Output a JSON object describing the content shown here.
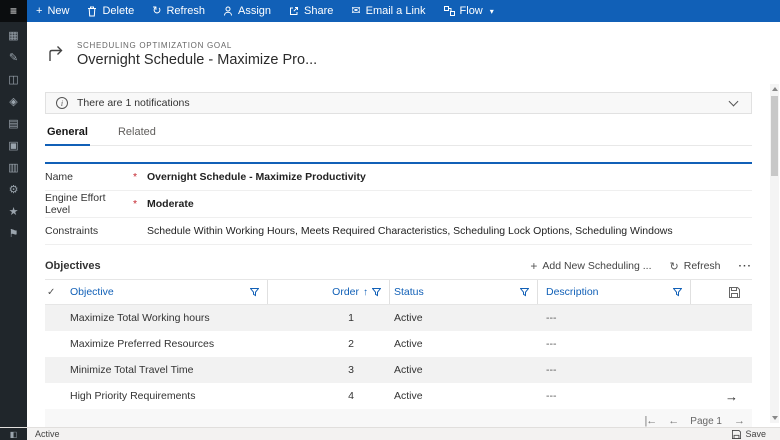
{
  "command_bar": {
    "menu_glyph": "≡",
    "items": [
      {
        "label": "New"
      },
      {
        "label": "Delete"
      },
      {
        "label": "Refresh"
      },
      {
        "label": "Assign"
      },
      {
        "label": "Share"
      },
      {
        "label": "Email a Link"
      },
      {
        "label": "Flow"
      }
    ],
    "glyphs": {
      "new": "+",
      "refresh": "↻",
      "email": "✉",
      "caret": "▾"
    }
  },
  "rail": {
    "icons": [
      "▦",
      "✎",
      "◫",
      "◈",
      "▤",
      "▣",
      "▥",
      "⚙",
      "★",
      "⚑"
    ]
  },
  "record": {
    "entity": "SCHEDULING OPTIMIZATION GOAL",
    "title": "Overnight Schedule - Maximize Pro..."
  },
  "notification": {
    "message": "There are 1 notifications",
    "info_glyph": "i"
  },
  "tabs": [
    {
      "label": "General"
    },
    {
      "label": "Related"
    }
  ],
  "form": {
    "fields": [
      {
        "label": "Name",
        "required": "*",
        "value": "Overnight Schedule - Maximize Productivity"
      },
      {
        "label": "Engine Effort Level",
        "required": "*",
        "value": "Moderate"
      },
      {
        "label": "Constraints",
        "required": "",
        "value": "Schedule Within Working Hours, Meets Required Characteristics, Scheduling Lock Options, Scheduling Windows"
      }
    ]
  },
  "subgrid": {
    "title": "Objectives",
    "add_label": "Add New Scheduling ...",
    "refresh_label": "Refresh",
    "more_label": "···",
    "check_icon": "✓",
    "sort_icon": "↑",
    "columns": {
      "objective": "Objective",
      "order": "Order",
      "status": "Status",
      "description": "Description"
    },
    "rows": [
      {
        "objective": "Maximize Total Working hours",
        "order": "1",
        "status": "Active",
        "description": "---"
      },
      {
        "objective": "Maximize Preferred Resources",
        "order": "2",
        "status": "Active",
        "description": "---"
      },
      {
        "objective": "Minimize Total Travel Time",
        "order": "3",
        "status": "Active",
        "description": "---"
      },
      {
        "objective": "High Priority Requirements",
        "order": "4",
        "status": "Active",
        "description": "---"
      }
    ],
    "open_arrow": "→",
    "pagination": {
      "first": "|←",
      "prev": "←",
      "label": "Page 1",
      "next": "→"
    }
  },
  "status_bar": {
    "status": "Active",
    "save_label": "Save",
    "square_glyph": "◧"
  },
  "colors": {
    "accent": "#1160b7",
    "required": "#c4262e",
    "rail_bg": "#20262b"
  }
}
